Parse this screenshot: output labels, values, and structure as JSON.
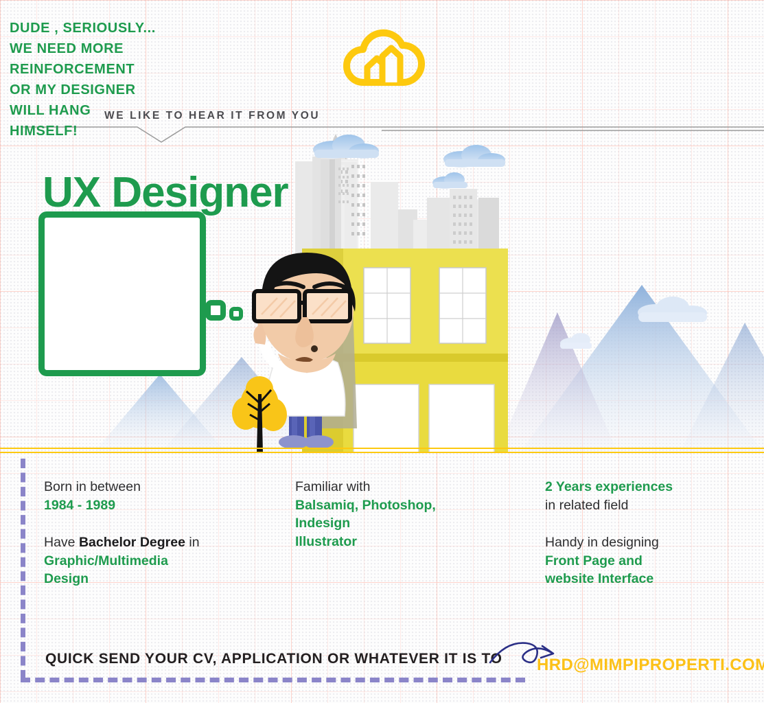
{
  "brand": {
    "logo_icon": "cloud-house-logo",
    "green": "#1e9b4e",
    "yellow": "#fdc90f",
    "orange": "#fcc118",
    "purple": "#8b85c9",
    "dark": "#231f20"
  },
  "header": {
    "kicker": "WE LIKE TO HEAR IT FROM YOU",
    "title": "UX Designer"
  },
  "speech_bubble": {
    "lines": [
      "DUDE , SERIOUSLY...",
      "WE NEED MORE",
      "REINFORCEMENT",
      "OR MY DESIGNER",
      "WILL HANG",
      "HIMSELF!"
    ]
  },
  "illustration": {
    "character": "cartoon-man-with-glasses",
    "tree": "yellow-tree",
    "building": "yellow-office-building",
    "skyline": "grey-city-skyline",
    "mountains": "blue-mountains",
    "clouds": "blue-clouds"
  },
  "requirements": {
    "columns": [
      {
        "blocks": [
          {
            "lines": [
              {
                "text": "Born in between",
                "style": "plain"
              },
              {
                "text": "1984 - 1989",
                "style": "green"
              }
            ]
          },
          {
            "lines": [
              {
                "text": "Have Bachelor Degree in",
                "style": "mixed",
                "bold_part": "Bachelor Degree"
              },
              {
                "text": "Graphic/Multimedia",
                "style": "green"
              },
              {
                "text": "Design",
                "style": "green"
              }
            ]
          }
        ]
      },
      {
        "blocks": [
          {
            "lines": [
              {
                "text": "Familiar with",
                "style": "plain"
              },
              {
                "text": "Balsamiq, Photoshop,",
                "style": "green"
              },
              {
                "text": "Indesign",
                "style": "green"
              },
              {
                "text": "Illustrator",
                "style": "green"
              }
            ]
          }
        ]
      },
      {
        "blocks": [
          {
            "lines": [
              {
                "text": "2 Years experiences",
                "style": "green"
              },
              {
                "text": "in related field",
                "style": "plain"
              }
            ]
          },
          {
            "lines": [
              {
                "text": "Handy in designing",
                "style": "plain"
              },
              {
                "text": "Front Page and",
                "style": "green"
              },
              {
                "text": "website Interface",
                "style": "green"
              }
            ]
          }
        ]
      }
    ]
  },
  "footer": {
    "cta": "QUICK SEND YOUR CV, APPLICATION OR WHATEVER IT IS TO",
    "email": "HRD@MIMPIPROPERTI.COM",
    "arrow_icon": "curly-arrow-icon"
  }
}
